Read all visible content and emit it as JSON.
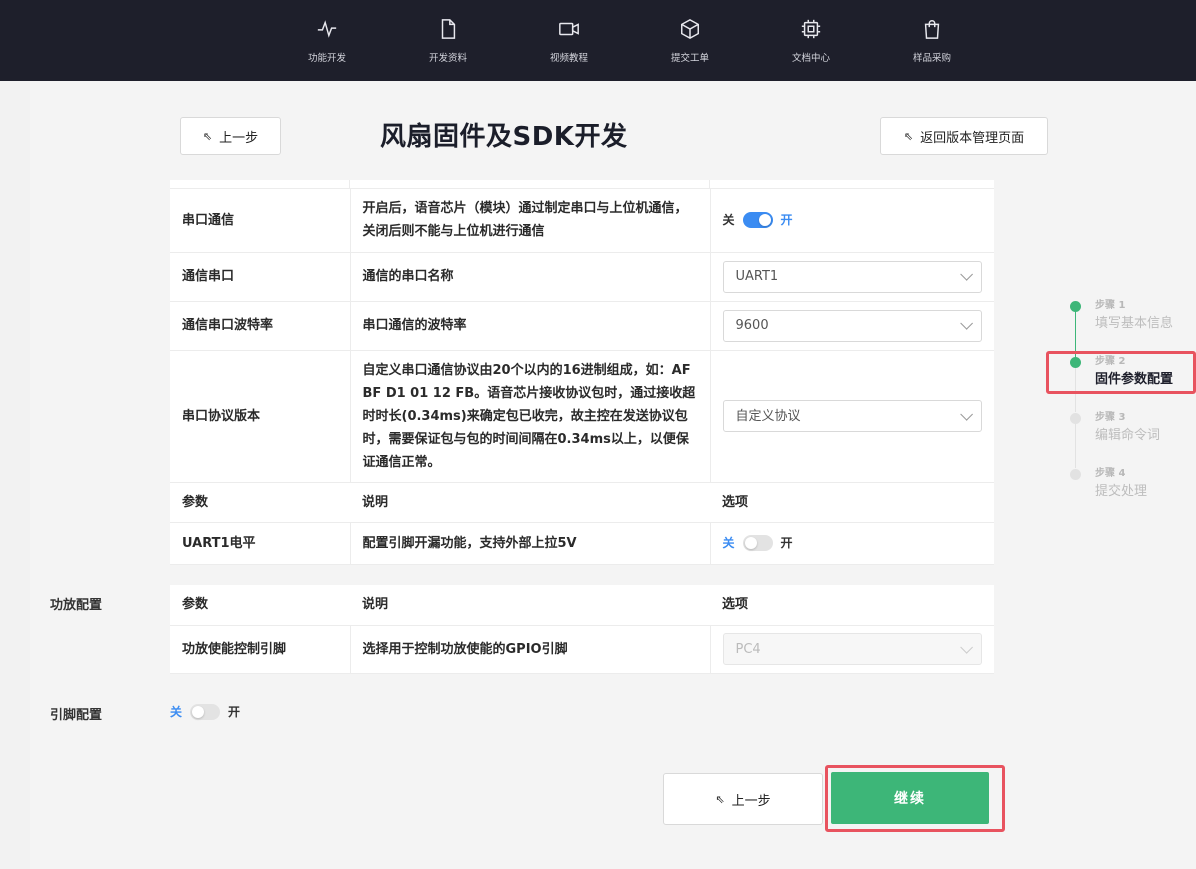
{
  "nav": {
    "items": [
      {
        "label": "功能开发",
        "icon": "activity-icon"
      },
      {
        "label": "开发资料",
        "icon": "document-icon"
      },
      {
        "label": "视频教程",
        "icon": "video-icon"
      },
      {
        "label": "提交工单",
        "icon": "box-icon"
      },
      {
        "label": "文档中心",
        "icon": "chip-icon"
      },
      {
        "label": "样品采购",
        "icon": "shopping-bag-icon"
      }
    ]
  },
  "header": {
    "prev_label": "上一步",
    "title": "风扇固件及SDK开发",
    "back_label": "返回版本管理页面"
  },
  "serial_table": {
    "rows": [
      {
        "param": "串口通信",
        "desc": "开启后，语音芯片（模块）通过制定串口与上位机通信，关闭后则不能与上位机进行通信",
        "switch_off": "关",
        "switch_on": "开",
        "switch_state": "on"
      },
      {
        "param": "通信串口",
        "desc": "通信的串口名称",
        "select": "UART1"
      },
      {
        "param": "通信串口波特率",
        "desc": "串口通信的波特率",
        "select": "9600"
      },
      {
        "param": "串口协议版本",
        "desc": "自定义串口通信协议由20个以内的16进制组成，如：AF BF D1 01 12 FB。语音芯片接收协议包时，通过接收超时时长(0.34ms)来确定包已收完，故主控在发送协议包时，需要保证包与包的时间间隔在0.34ms以上，以便保证通信正常。",
        "select": "自定义协议"
      }
    ],
    "sub_header": {
      "param": "参数",
      "desc": "说明",
      "option": "选项"
    },
    "uart_row": {
      "param": "UART1电平",
      "desc": "配置引脚开漏功能，支持外部上拉5V",
      "switch_off": "关",
      "switch_on": "开",
      "switch_state": "off"
    }
  },
  "amp_section": {
    "label": "功放配置",
    "header": {
      "param": "参数",
      "desc": "说明",
      "option": "选项"
    },
    "row": {
      "param": "功放使能控制引脚",
      "desc": "选择用于控制功放使能的GPIO引脚",
      "select": "PC4"
    }
  },
  "pin_section": {
    "label": "引脚配置",
    "switch_off": "关",
    "switch_on": "开",
    "switch_state": "off"
  },
  "steps": [
    {
      "num": "步骤 1",
      "title": "填写基本信息",
      "status": "done"
    },
    {
      "num": "步骤 2",
      "title": "固件参数配置",
      "status": "current"
    },
    {
      "num": "步骤 3",
      "title": "编辑命令词",
      "status": "pending"
    },
    {
      "num": "步骤 4",
      "title": "提交处理",
      "status": "pending"
    }
  ],
  "footer": {
    "prev_label": "上一步",
    "continue_label": "继续"
  },
  "colors": {
    "navbar": "#1e1f2b",
    "accent_blue": "#3b8cf2",
    "accent_green": "#3db678",
    "highlight_red": "#e8535f"
  }
}
